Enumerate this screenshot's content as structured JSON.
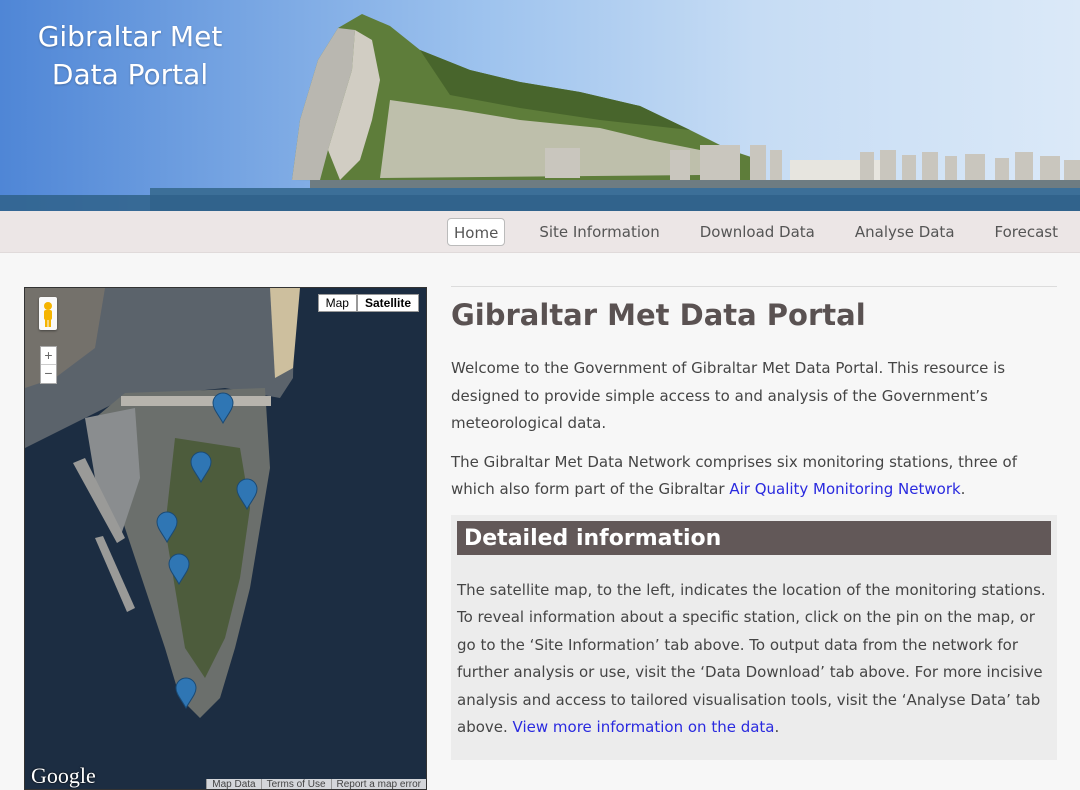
{
  "header": {
    "title_line1": "Gibraltar Met",
    "title_line2": "Data Portal"
  },
  "nav": {
    "items": [
      {
        "label": "Home",
        "active": true
      },
      {
        "label": "Site Information",
        "active": false
      },
      {
        "label": "Download Data",
        "active": false
      },
      {
        "label": "Analyse Data",
        "active": false
      },
      {
        "label": "Forecast",
        "active": false
      }
    ]
  },
  "map": {
    "maptype_map": "Map",
    "maptype_satellite": "Satellite",
    "zoom_in": "+",
    "zoom_out": "−",
    "logo": "Google",
    "footer": [
      "Map Data",
      "Terms of Use",
      "Report a map error"
    ],
    "pin_count": 6,
    "pin_color": "#2f76b4"
  },
  "main": {
    "title": "Gibraltar Met Data Portal",
    "para1": "Welcome to the Government of Gibraltar Met Data Portal. This resource is designed to provide simple access to and analysis of the Government’s meteorological data.",
    "para2_text": "The Gibraltar Met Data Network comprises six monitoring stations, three of which also form part of the Gibraltar ",
    "para2_link": "Air Quality Monitoring Network",
    "para2_end": ".",
    "detail_heading": "Detailed information",
    "detail_text": "The satellite map, to the left, indicates the location of the monitoring stations. To reveal information about a specific station, click on the pin on the map, or go to the ‘Site Information’ tab above. To output data from the network for further analysis or use, visit the ‘Data Download’ tab above. For more incisive analysis and access to tailored visualisation tools, visit the ‘Analyse Data’ tab above. ",
    "detail_link": "View more information on the data",
    "detail_end": "."
  },
  "colors": {
    "link": "#2a2adf",
    "heading_bar": "#625858",
    "nav_bg": "#ece6e6"
  }
}
